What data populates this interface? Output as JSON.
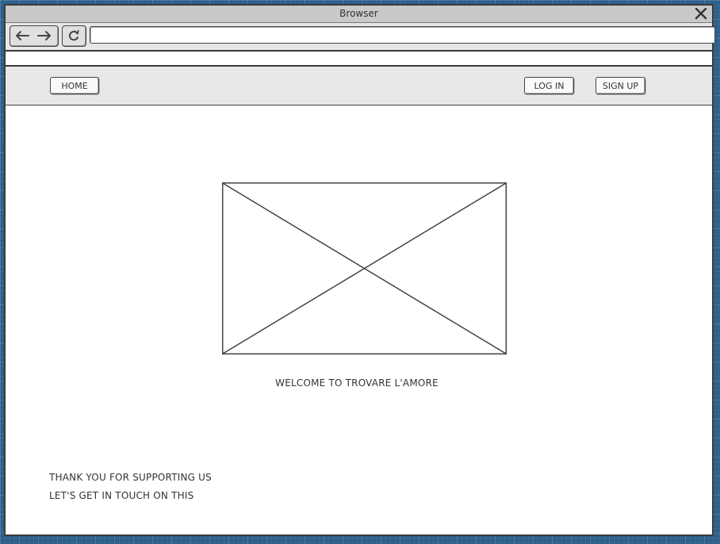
{
  "window": {
    "title": "Browser"
  },
  "toolbar": {
    "url": "",
    "url_placeholder": ""
  },
  "header": {
    "home_label": "HOME",
    "login_label": "LOG IN",
    "signup_label": "SIGN UP"
  },
  "main": {
    "welcome_text": "WELCOME TO TROVARE L'AMORE"
  },
  "footer": {
    "line1": "THANK YOU FOR SUPPORTING US",
    "line2": "LET'S GET IN TOUCH ON THIS"
  },
  "icons": {
    "close": "close-icon",
    "back": "back-arrow-icon",
    "forward": "forward-arrow-icon",
    "reload": "reload-icon",
    "image_placeholder": "image-placeholder-icon"
  },
  "colors": {
    "desktop_background": "#2d5f8c",
    "titlebar": "#c9c9c9",
    "header_background": "#e8e8e8",
    "outline": "#3a3a3a"
  }
}
